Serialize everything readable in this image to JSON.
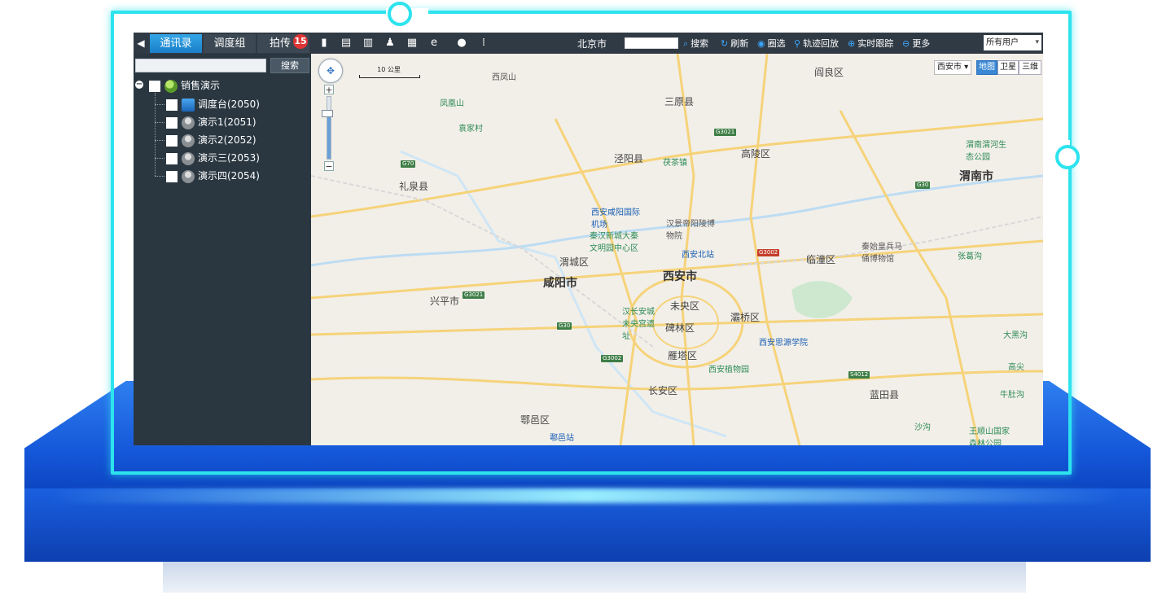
{
  "tabs": [
    {
      "label": "通讯录",
      "active": true
    },
    {
      "label": "调度组",
      "active": false
    },
    {
      "label": "拍传",
      "active": false
    }
  ],
  "badge_count": "15",
  "toolbar": {
    "city": "北京市",
    "search_value": "",
    "actions": [
      {
        "label": "搜索",
        "icon": "search-icon"
      },
      {
        "label": "刷新",
        "icon": "refresh-icon"
      },
      {
        "label": "圈选",
        "icon": "circle-select-icon"
      },
      {
        "label": "轨迹回放",
        "icon": "track-replay-icon"
      },
      {
        "label": "实时跟踪",
        "icon": "live-tracking-icon"
      },
      {
        "label": "更多",
        "icon": "more-icon"
      }
    ],
    "user_filter": "所有用户"
  },
  "sidebar": {
    "search_value": "",
    "search_button": "搜索",
    "tree": {
      "root": "销售演示",
      "children": [
        "调度台(2050)",
        "演示1(2051)",
        "演示2(2052)",
        "演示三(2053)",
        "演示四(2054)"
      ]
    }
  },
  "map": {
    "scale_label": "10 公里",
    "city_select": "西安市",
    "map_types": [
      "地图",
      "卫星",
      "三维"
    ],
    "active_map_type": "地图",
    "zoom_level_fraction": 0.75,
    "labels": {
      "xian": "西安市",
      "xianyang": "咸阳市",
      "weinan": "渭南市",
      "gaoling": "高陵区",
      "lintong": "临潼区",
      "weicheng": "渭城区",
      "weiyang": "未央区",
      "beilin": "碑林区",
      "baqiao": "灞桥区",
      "yanta": "雁塔区",
      "changan": "长安区",
      "huyi": "鄠邑区",
      "lantian": "蓝田县",
      "sanyuan": "三原县",
      "jingyang": "泾阳县",
      "liquan": "礼泉县",
      "xingping": "兴平市",
      "yanliang": "阎良区",
      "airport": "西安咸阳国际机场",
      "north_station": "西安北站",
      "museum": "汉景帝阳陵博物院",
      "qinhan": "秦汉新城大秦文明园中心区",
      "hanchangan": "汉长安城未央宫遗址",
      "siyuan": "西安思源学院",
      "botanical": "西安植物园",
      "terracotta": "秦始皇兵马俑博物馆",
      "huyi_station": "鄠邑站",
      "fengmingshan": "凤凰山",
      "yuanjiacun": "袁家村",
      "maocha": "茯茶镇",
      "lishan": "张葛沟",
      "weinan_park": "渭南渭河生态公园",
      "dahei": "大黑沟",
      "gaojian": "高尖",
      "niudu": "牛肚沟",
      "shahe": "沙沟",
      "wangshunshan": "王顺山国家森林公园",
      "xifengshan": "西凤山"
    }
  }
}
